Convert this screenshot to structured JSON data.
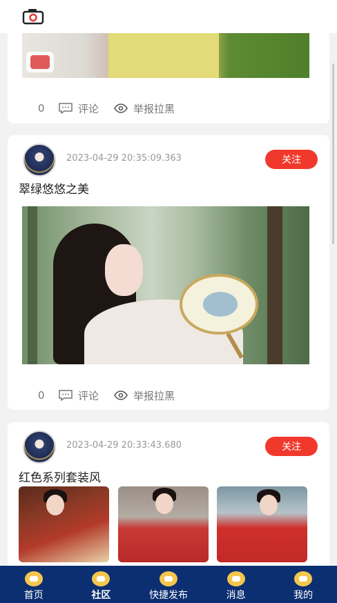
{
  "topbar": {
    "camera_icon": "camera-icon"
  },
  "posts": [
    {
      "likes": "0",
      "comment_label": "评论",
      "report_label": "举报拉黑"
    },
    {
      "timestamp": "2023-04-29 20:35:09.363",
      "follow_label": "关注",
      "title": "翠绿悠悠之美",
      "likes": "0",
      "comment_label": "评论",
      "report_label": "举报拉黑"
    },
    {
      "timestamp": "2023-04-29 20:33:43.680",
      "follow_label": "关注",
      "title": "红色系列套装风"
    }
  ],
  "tabbar": {
    "items": [
      {
        "label": "首页",
        "icon": "home-icon"
      },
      {
        "label": "社区",
        "icon": "community-icon"
      },
      {
        "label": "快捷发布",
        "icon": "publish-icon"
      },
      {
        "label": "消息",
        "icon": "message-icon"
      },
      {
        "label": "我的",
        "icon": "profile-icon"
      }
    ],
    "active": "社区"
  },
  "colors": {
    "follow": "#f0392c",
    "tabbar": "#0c2f72",
    "tab_icon": "#f3c64d"
  }
}
